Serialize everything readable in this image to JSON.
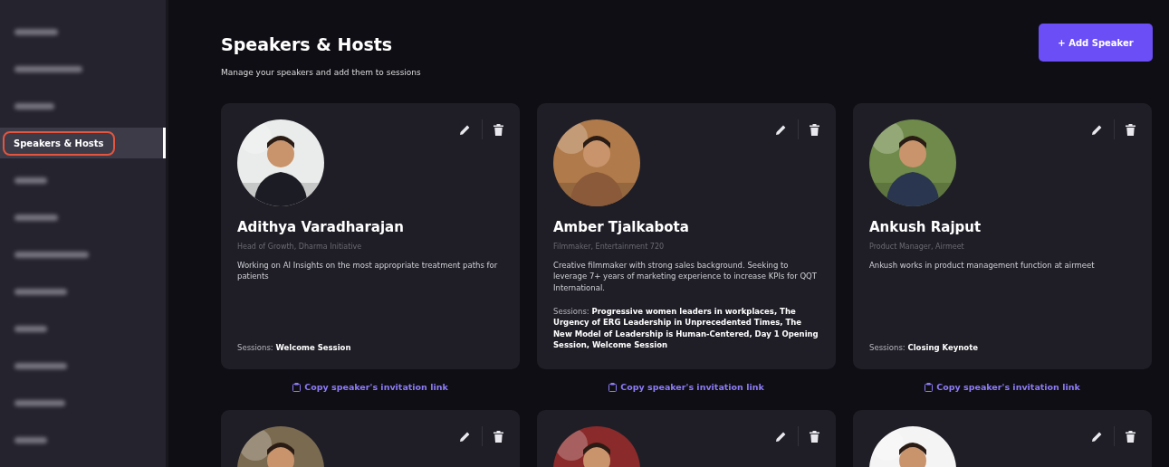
{
  "sidebar": {
    "items": [
      {
        "kind": "blurred",
        "selected": false
      },
      {
        "kind": "blurred",
        "selected": false
      },
      {
        "kind": "blurred",
        "selected": false
      },
      {
        "kind": "text",
        "label": "Speakers & Hosts",
        "selected": true,
        "annotated": true
      },
      {
        "kind": "blurred",
        "selected": false
      },
      {
        "kind": "blurred",
        "selected": false
      },
      {
        "kind": "blurred",
        "selected": false
      },
      {
        "kind": "blurred",
        "selected": false
      },
      {
        "kind": "blurred",
        "selected": false
      },
      {
        "kind": "blurred",
        "selected": false
      },
      {
        "kind": "blurred",
        "selected": false
      },
      {
        "kind": "blurred",
        "selected": false
      }
    ]
  },
  "header": {
    "title": "Speakers & Hosts",
    "subtitle": "Manage your speakers and add them to sessions",
    "add_button": "+ Add Speaker"
  },
  "speakers": [
    {
      "kind": "picture",
      "name": "Adithya Varadharajan",
      "role": "Head of Growth, Dharma Initiative",
      "bio": "Working on AI Insights on the most appropriate treatment paths for patients",
      "sessions_label": "Sessions:",
      "sessions": "Welcome Session",
      "invite_link": "Copy speaker's invitation link"
    },
    {
      "kind": "picture",
      "name": "Amber Tjalkabota",
      "role": "Filmmaker, Entertainment 720",
      "bio": "Creative filmmaker with strong sales background. Seeking to leverage 7+ years of marketing experience to increase KPIs for QQT International.",
      "sessions_label": "Sessions:",
      "sessions": "Progressive women leaders in workplaces, The Urgency of ERG Leadership in Unprecedented Times, The New Model of Leadership is Human-Centered, Day 1 Opening Session, Welcome Session",
      "invite_link": "Copy speaker's invitation link"
    },
    {
      "kind": "picture",
      "name": "Ankush Rajput",
      "role": "Product Manager, Airmeet",
      "bio": "Ankush works in product management function at airmeet",
      "sessions_label": "Sessions:",
      "sessions": "Closing Keynote",
      "invite_link": "Copy speaker's invitation link"
    },
    {
      "kind": "picture"
    },
    {
      "kind": "picture"
    },
    {
      "kind": "picture"
    }
  ]
}
